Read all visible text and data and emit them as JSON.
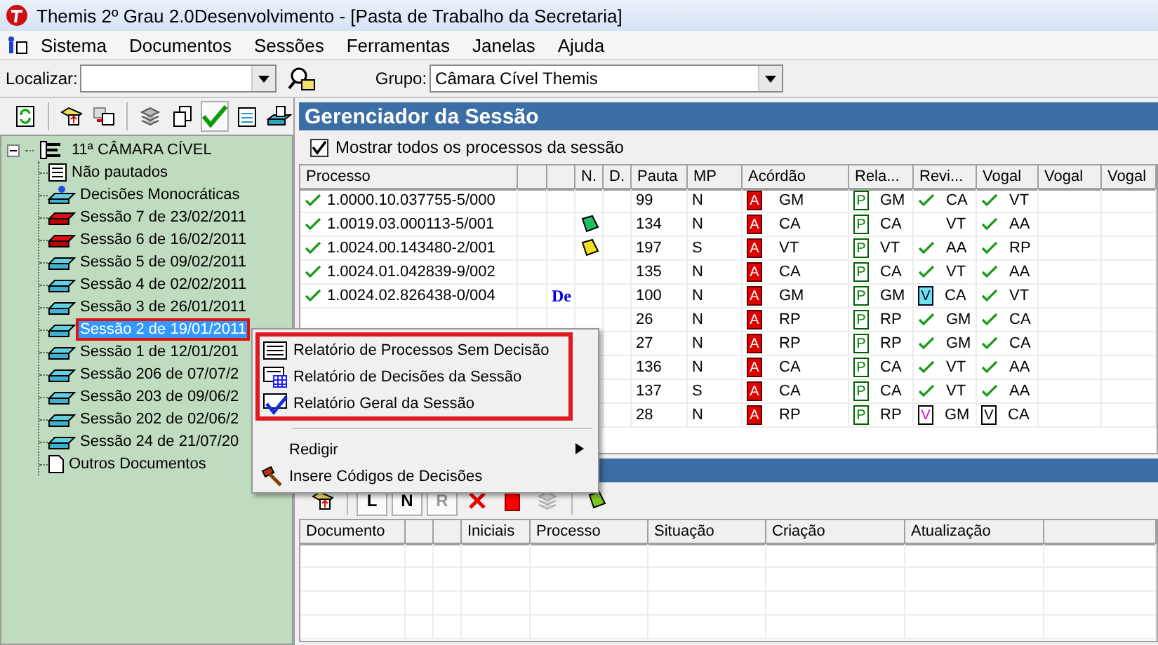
{
  "window": {
    "title": "Themis 2º Grau 2.0Desenvolvimento - [Pasta de Trabalho da Secretaria]"
  },
  "menu": [
    "Sistema",
    "Documentos",
    "Sessões",
    "Ferramentas",
    "Janelas",
    "Ajuda"
  ],
  "search": {
    "label": "Localizar:",
    "group_label": "Grupo:",
    "group_value": "Câmara Cível Themis"
  },
  "left_toolbar": [
    {
      "kind": "refresh",
      "pressed": false
    },
    {
      "kind": "sep"
    },
    {
      "kind": "add",
      "pressed": false
    },
    {
      "kind": "move",
      "pressed": false
    },
    {
      "kind": "sep"
    },
    {
      "kind": "stack",
      "pressed": false
    },
    {
      "kind": "copy",
      "pressed": false
    },
    {
      "kind": "check",
      "pressed": true
    },
    {
      "kind": "notes",
      "pressed": false
    },
    {
      "kind": "print",
      "pressed": false
    }
  ],
  "tree": {
    "label": "11ª  CÂMARA CÍVEL",
    "expanded": true,
    "children": [
      {
        "label": "Não pautados",
        "kind": "list",
        "selected": false,
        "highlighted": false
      },
      {
        "label": "Decisões Monocráticas",
        "kind": "mono",
        "selected": false,
        "highlighted": false
      },
      {
        "label": "Sessão 7 de 23/02/2011",
        "kind": "closed",
        "selected": false,
        "highlighted": false
      },
      {
        "label": "Sessão 6 de 16/02/2011",
        "kind": "closed",
        "selected": false,
        "highlighted": false
      },
      {
        "label": "Sessão 5 de 09/02/2011",
        "kind": "session",
        "selected": false,
        "highlighted": false
      },
      {
        "label": "Sessão 4 de 02/02/2011",
        "kind": "session",
        "selected": false,
        "highlighted": false
      },
      {
        "label": "Sessão 3 de 26/01/2011",
        "kind": "session",
        "selected": false,
        "highlighted": false
      },
      {
        "label": "Sessão 2 de 19/01/2011",
        "kind": "session",
        "selected": true,
        "highlighted": true
      },
      {
        "label": "Sessão 1 de 12/01/201",
        "kind": "session",
        "selected": false,
        "highlighted": false
      },
      {
        "label": "Sessão 206 de 07/07/2",
        "kind": "session",
        "selected": false,
        "highlighted": false
      },
      {
        "label": "Sessão 203 de 09/06/2",
        "kind": "session",
        "selected": false,
        "highlighted": false
      },
      {
        "label": "Sessão 202 de 02/06/2",
        "kind": "session",
        "selected": false,
        "highlighted": false
      },
      {
        "label": "Sessão 24 de 21/07/20",
        "kind": "session",
        "selected": false,
        "highlighted": false
      },
      {
        "label": "Outros Documentos",
        "kind": "doc",
        "selected": false,
        "highlighted": false
      }
    ]
  },
  "session": {
    "title": "Gerenciador da Sessão",
    "show_all": {
      "label": "Mostrar todos os processos da sessão",
      "checked": true
    },
    "columns": [
      "Processo",
      "",
      "",
      "N.",
      "D.",
      "Pauta",
      "MP",
      "Acórdão",
      "Rela...",
      "Revi...",
      "Vogal",
      "Vogal",
      "Vogal"
    ],
    "rows": [
      {
        "processo": "1.0000.10.037755-5/000",
        "pauta": "99",
        "mp": "N",
        "acordao_badge": "A",
        "acordao": "GM",
        "relator_badge": "P",
        "relator": "GM",
        "revisor_mark": {
          "kind": "check"
        },
        "revisor": "CA",
        "vogal_mark": {
          "kind": "check"
        },
        "vogal": "VT"
      },
      {
        "processo": "1.0019.03.000113-5/001",
        "flag": {
          "color": "#20c060"
        },
        "pauta": "134",
        "mp": "N",
        "acordao_badge": "A",
        "acordao": "CA",
        "relator_badge": "P",
        "relator": "CA",
        "revisor_mark": {
          "kind": "none"
        },
        "revisor": "VT",
        "vogal_mark": {
          "kind": "check"
        },
        "vogal": "AA"
      },
      {
        "processo": "1.0024.00.143480-2/001",
        "flag": {
          "color": "#f0e020"
        },
        "pauta": "197",
        "mp": "S",
        "acordao_badge": "A",
        "acordao": "VT",
        "relator_badge": "P",
        "relator": "VT",
        "revisor_mark": {
          "kind": "check"
        },
        "revisor": "AA",
        "vogal_mark": {
          "kind": "check"
        },
        "vogal": "RP"
      },
      {
        "processo": "1.0024.01.042839-9/002",
        "pauta": "135",
        "mp": "N",
        "acordao_badge": "A",
        "acordao": "CA",
        "relator_badge": "P",
        "relator": "CA",
        "revisor_mark": {
          "kind": "check"
        },
        "revisor": "VT",
        "vogal_mark": {
          "kind": "check"
        },
        "vogal": "AA"
      },
      {
        "processo": "1.0024.02.826438-0/004",
        "de": "De",
        "pauta": "100",
        "mp": "N",
        "acordao_badge": "A",
        "acordao": "GM",
        "relator_badge": "P",
        "relator": "GM",
        "revisor_mark": {
          "kind": "doc_cyan",
          "letter": "V"
        },
        "revisor": "CA",
        "vogal_mark": {
          "kind": "check"
        },
        "vogal": "VT"
      },
      {
        "pauta": "26",
        "mp": "N",
        "acordao_badge": "A",
        "acordao": "RP",
        "relator_badge": "P",
        "relator": "RP",
        "revisor_mark": {
          "kind": "check"
        },
        "revisor": "GM",
        "vogal_mark": {
          "kind": "check"
        },
        "vogal": "CA"
      },
      {
        "pauta": "27",
        "mp": "N",
        "acordao_badge": "A",
        "acordao": "RP",
        "relator_badge": "P",
        "relator": "RP",
        "revisor_mark": {
          "kind": "check"
        },
        "revisor": "GM",
        "vogal_mark": {
          "kind": "check"
        },
        "vogal": "CA"
      },
      {
        "pauta": "136",
        "mp": "N",
        "acordao_badge": "A",
        "acordao": "CA",
        "relator_badge": "P",
        "relator": "CA",
        "revisor_mark": {
          "kind": "check"
        },
        "revisor": "VT",
        "vogal_mark": {
          "kind": "check"
        },
        "vogal": "AA"
      },
      {
        "pauta": "137",
        "mp": "S",
        "acordao_badge": "A",
        "acordao": "CA",
        "relator_badge": "P",
        "relator": "CA",
        "revisor_mark": {
          "kind": "check"
        },
        "revisor": "VT",
        "vogal_mark": {
          "kind": "check"
        },
        "vogal": "AA"
      },
      {
        "pauta": "28",
        "mp": "N",
        "acordao_badge": "A",
        "acordao": "RP",
        "relator_badge": "P",
        "relator": "RP",
        "revisor_mark": {
          "kind": "doc_magenta",
          "letter": "V"
        },
        "revisor": "GM",
        "vogal_mark": {
          "kind": "doc",
          "letter": "V"
        },
        "vogal": "CA"
      }
    ]
  },
  "documents": {
    "toolbar": [
      {
        "kind": "add",
        "disabled": false
      },
      {
        "kind": "sep"
      },
      {
        "kind": "letter",
        "label": "L",
        "disabled": false
      },
      {
        "kind": "letter",
        "label": "N",
        "disabled": false
      },
      {
        "kind": "letter",
        "label": "R",
        "disabled": true
      },
      {
        "kind": "delete",
        "disabled": false
      },
      {
        "kind": "reddoc",
        "disabled": false
      },
      {
        "kind": "stack",
        "disabled": true
      },
      {
        "kind": "sep"
      },
      {
        "kind": "flag",
        "disabled": false
      }
    ],
    "columns": [
      "Documento",
      "",
      "",
      "Iniciais",
      "Processo",
      "Situação",
      "Criação",
      "Atualização",
      ""
    ]
  },
  "context_menu": [
    {
      "label": "Relatório de Processos Sem Decisão",
      "kind": "report",
      "highlighted": true
    },
    {
      "label": "Relatório de Decisões da Sessão",
      "kind": "calendar",
      "highlighted": true
    },
    {
      "label": "Relatório Geral da Sessão",
      "kind": "checked",
      "highlighted": true
    },
    {
      "kind": "separator"
    },
    {
      "label": "Redigir",
      "kind": "submenu",
      "highlighted": false
    },
    {
      "label": "Insere Códigos de Decisões",
      "kind": "gavel",
      "highlighted": false
    }
  ]
}
